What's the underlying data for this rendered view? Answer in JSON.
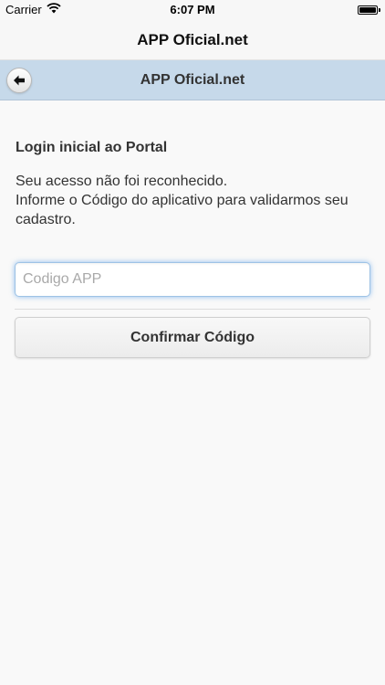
{
  "status_bar": {
    "carrier": "Carrier",
    "time": "6:07 PM"
  },
  "nav_bar": {
    "title": "APP Oficial.net"
  },
  "header": {
    "title": "APP Oficial.net",
    "back_icon": "arrow-left-icon"
  },
  "content": {
    "heading": "Login inicial ao Portal",
    "message_line1": "Seu acesso não foi reconhecido.",
    "message_line2": "Informe o Código do aplicativo para validarmos seu cadastro."
  },
  "form": {
    "code_placeholder": "Codigo APP",
    "code_value": "",
    "confirm_label": "Confirmar Código"
  },
  "colors": {
    "header_bg": "#c6d9ea",
    "input_focus": "#388ce6"
  }
}
